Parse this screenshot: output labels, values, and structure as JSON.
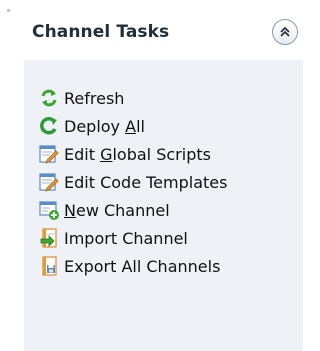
{
  "header": {
    "title": "Channel Tasks",
    "collapse_icon": "double-chevron-up-icon"
  },
  "tasks": [
    {
      "name": "refresh",
      "label": "Refresh",
      "mnemonic": "",
      "icon": "refresh-icon"
    },
    {
      "name": "deploy-all",
      "label": "Deploy All",
      "mnemonic": "A",
      "icon": "deploy-icon"
    },
    {
      "name": "edit-global-scripts",
      "label": "Edit Global Scripts",
      "mnemonic": "G",
      "icon": "edit-document-icon"
    },
    {
      "name": "edit-code-templates",
      "label": "Edit Code Templates",
      "mnemonic": "",
      "icon": "edit-document-icon"
    },
    {
      "name": "new-channel",
      "label": "New Channel",
      "mnemonic": "N",
      "icon": "new-channel-icon"
    },
    {
      "name": "import-channel",
      "label": "Import Channel",
      "mnemonic": "",
      "icon": "import-icon"
    },
    {
      "name": "export-all-channels",
      "label": "Export All Channels",
      "mnemonic": "",
      "icon": "export-icon"
    }
  ],
  "colors": {
    "panel_background": "#eef1f6",
    "title_text": "#1f2f3f",
    "refresh_green": "#3aa62f",
    "deploy_green": "#2e9a3a",
    "edit_orange": "#e89a2c",
    "doc_blue": "#5b8bc8"
  }
}
